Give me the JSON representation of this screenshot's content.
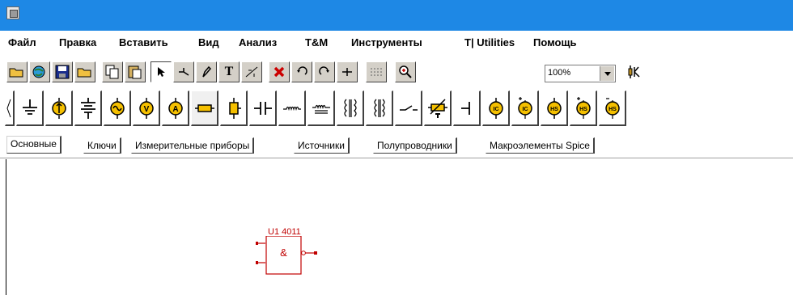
{
  "menu": {
    "items": [
      "Файл",
      "Правка",
      "Вставить",
      "Вид",
      "Анализ",
      "T&M",
      "Инструменты",
      "T| Utilities",
      "Помощь"
    ]
  },
  "toolbar": {
    "zoom_value": "100%"
  },
  "tabs": [
    {
      "label": "Основные",
      "active": true
    },
    {
      "label": "Ключи"
    },
    {
      "label": "Измерительные приборы"
    },
    {
      "label": "Источники"
    },
    {
      "label": "Полупроводники"
    },
    {
      "label": "Макроэлементы Spice"
    }
  ],
  "canvas": {
    "component_label": "U1 4011",
    "gate_symbol": "&"
  },
  "colors": {
    "titlebar": "#1e88e5",
    "component": "#c00000",
    "tab_active": "#ffffff"
  }
}
